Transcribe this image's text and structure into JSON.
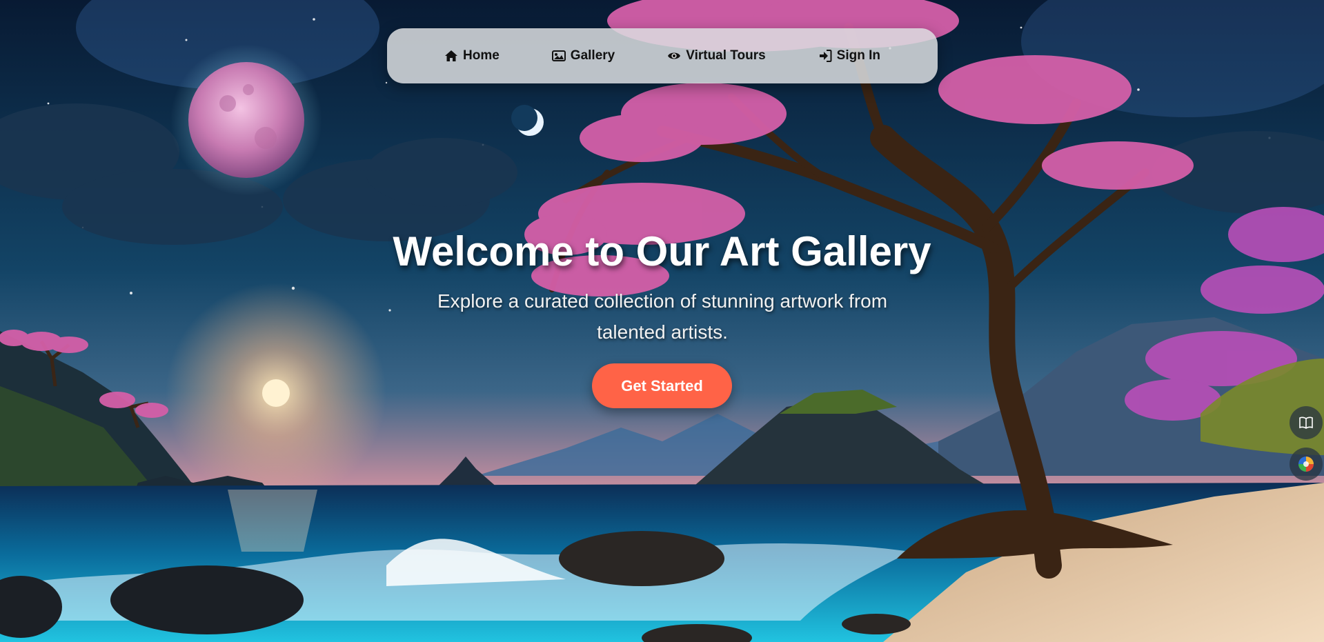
{
  "nav": {
    "items": [
      {
        "label": "Home",
        "icon": "home-icon"
      },
      {
        "label": "Gallery",
        "icon": "image-icon"
      },
      {
        "label": "Virtual Tours",
        "icon": "eye-icon"
      },
      {
        "label": "Sign In",
        "icon": "sign-in-icon"
      }
    ]
  },
  "hero": {
    "title": "Welcome to Our Art Gallery",
    "subtitle": "Explore a curated collection of stunning artwork from talented artists.",
    "cta_label": "Get Started"
  },
  "side_buttons": [
    {
      "icon": "book-icon"
    },
    {
      "icon": "color-palette-icon"
    }
  ],
  "colors": {
    "cta": "#ff6347",
    "nav_background": "#dcdee0",
    "text_light": "#ffffff",
    "blossom": "#d45fa8",
    "moon": "#d98ac0"
  }
}
